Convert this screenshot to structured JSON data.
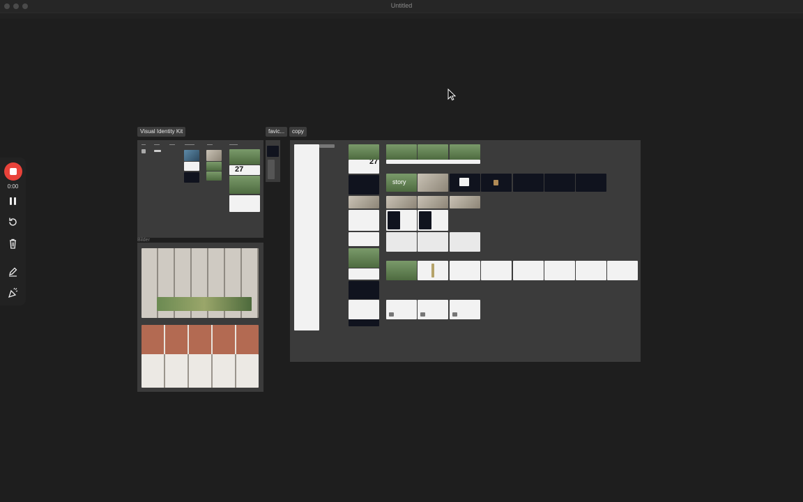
{
  "window": {
    "title": "Untitled"
  },
  "frames": {
    "visual_identity": "Visual Identity Kit",
    "favicon": "favic...",
    "copy": "copy",
    "images": "Bilder"
  },
  "thumb_text": {
    "number": "27",
    "story": "story"
  },
  "recorder": {
    "timer": "0:00"
  },
  "colors": {
    "background": "#1e1e1e",
    "canvas_frame": "#3b3b3b",
    "record_red": "#e8423a"
  },
  "icons": [
    "stop-icon",
    "pause-icon",
    "restart-icon",
    "trash-icon",
    "pen-icon",
    "confetti-icon",
    "cursor-icon"
  ]
}
